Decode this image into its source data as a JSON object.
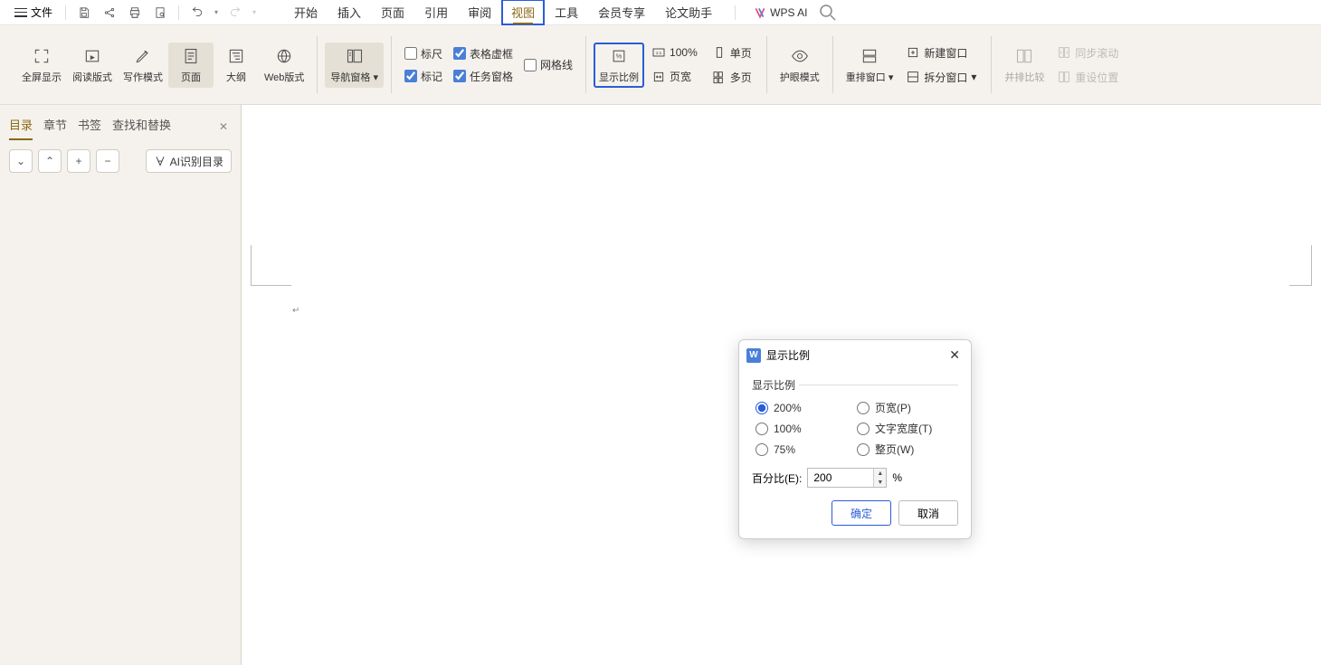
{
  "top": {
    "file": "文件",
    "tabs": [
      "开始",
      "插入",
      "页面",
      "引用",
      "审阅",
      "视图",
      "工具",
      "会员专享",
      "论文助手"
    ],
    "active_tab": "视图",
    "ai": "WPS AI"
  },
  "ribbon": {
    "fullscreen": "全屏显示",
    "reading": "阅读版式",
    "writing": "写作模式",
    "page": "页面",
    "outline": "大纲",
    "web": "Web版式",
    "navpane": "导航窗格",
    "ruler": "标尺",
    "table_border": "表格虚框",
    "gridlines": "网格线",
    "mark": "标记",
    "taskpane": "任务窗格",
    "zoom": "显示比例",
    "hundred": "100%",
    "single": "单页",
    "pagewidth": "页宽",
    "multi": "多页",
    "eye": "护眼模式",
    "rearrange": "重排窗口",
    "newwin": "新建窗口",
    "split": "拆分窗口",
    "sidebyside": "并排比较",
    "syncscroll": "同步滚动",
    "resetpos": "重设位置"
  },
  "sidebar": {
    "tabs": [
      "目录",
      "章节",
      "书签",
      "查找和替换"
    ],
    "active": "目录",
    "ai_button": "AI识别目录"
  },
  "dialog": {
    "title": "显示比例",
    "section": "显示比例",
    "options": {
      "p200": "200%",
      "p100": "100%",
      "p75": "75%",
      "pagewidth": "页宽(P)",
      "textwidth": "文字宽度(T)",
      "whole": "整页(W)"
    },
    "percent_label": "百分比(E):",
    "percent_value": "200",
    "percent_sign": "%",
    "ok": "确定",
    "cancel": "取消"
  }
}
